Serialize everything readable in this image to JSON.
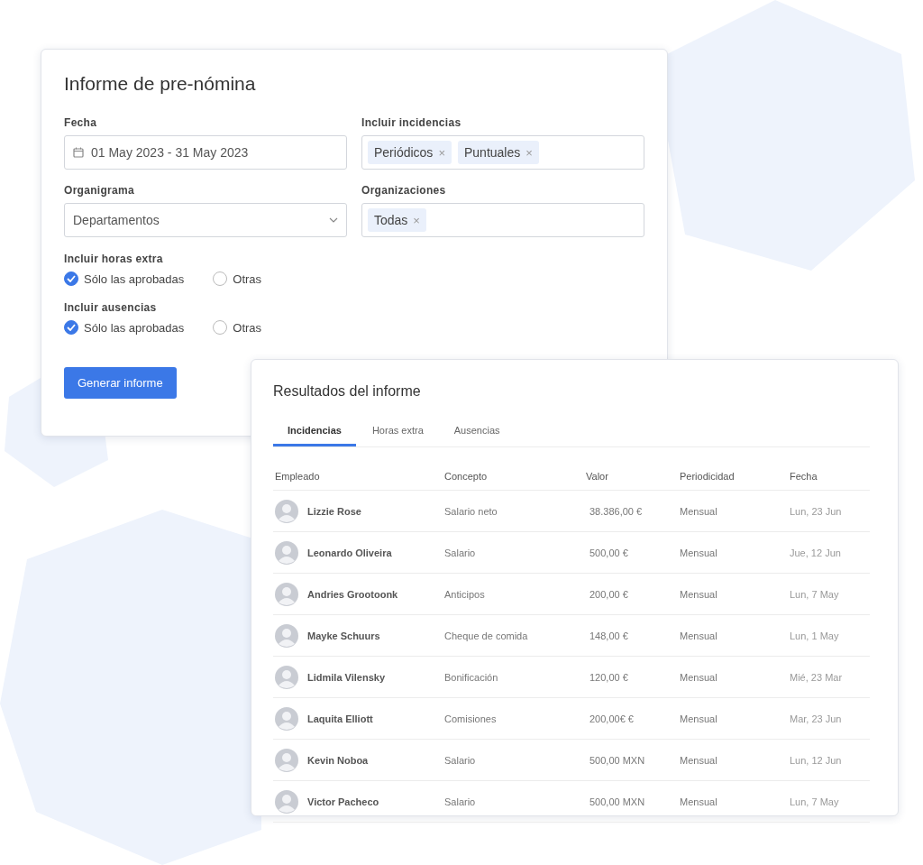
{
  "form": {
    "title": "Informe de pre-nómina",
    "fields": [
      {
        "kind": "date",
        "label": "Fecha",
        "value": "01 May 2023 - 31 May 2023"
      },
      {
        "kind": "tags",
        "label": "Incluir incidencias",
        "tags": [
          "Periódicos",
          "Puntuales"
        ],
        "remove": "×"
      },
      {
        "kind": "select",
        "label": "Organigrama",
        "value": "Departamentos"
      },
      {
        "kind": "tags",
        "label": "Organizaciones",
        "tags": [
          "Todas"
        ],
        "remove": "×"
      }
    ],
    "groups": [
      {
        "label": "Incluir horas extra",
        "options": [
          {
            "label": "Sólo las aprobadas",
            "checked": true
          },
          {
            "label": "Otras",
            "checked": false
          }
        ]
      },
      {
        "label": "Incluir ausencias",
        "options": [
          {
            "label": "Sólo las aprobadas",
            "checked": true
          },
          {
            "label": "Otras",
            "checked": false
          }
        ]
      }
    ],
    "button": "Generar informe"
  },
  "results": {
    "title": "Resultados del informe",
    "tabs": [
      {
        "label": "Incidencias",
        "selected": true
      },
      {
        "label": "Horas extra",
        "selected": false
      },
      {
        "label": "Ausencias",
        "selected": false
      }
    ],
    "columns": [
      "Empleado",
      "Concepto",
      "Valor",
      "Periodicidad",
      "Fecha"
    ],
    "rows": [
      {
        "employee": "Lizzie Rose",
        "concept": "Salario neto",
        "value": "38.386,00 €",
        "period": "Mensual",
        "date": "Lun, 23 Jun"
      },
      {
        "employee": "Leonardo Oliveira",
        "concept": "Salario",
        "value": "500,00 €",
        "period": "Mensual",
        "date": "Jue, 12 Jun"
      },
      {
        "employee": "Andries Grootoonk",
        "concept": "Anticipos",
        "value": "200,00 €",
        "period": "Mensual",
        "date": "Lun, 7 May"
      },
      {
        "employee": "Mayke Schuurs",
        "concept": "Cheque de comida",
        "value": "148,00 €",
        "period": "Mensual",
        "date": "Lun, 1 May"
      },
      {
        "employee": "Lidmila Vilensky",
        "concept": "Bonificación",
        "value": "120,00 €",
        "period": "Mensual",
        "date": "Mié, 23 Mar"
      },
      {
        "employee": "Laquita Elliott",
        "concept": "Comisiones",
        "value": "200,00€ €",
        "period": "Mensual",
        "date": "Mar, 23 Jun"
      },
      {
        "employee": "Kevin Noboa",
        "concept": "Salario",
        "value": "500,00 MXN",
        "period": "Mensual",
        "date": "Lun, 12 Jun"
      },
      {
        "employee": "Victor Pacheco",
        "concept": "Salario",
        "value": "500,00 MXN",
        "period": "Mensual",
        "date": "Lun, 7 May"
      }
    ]
  }
}
